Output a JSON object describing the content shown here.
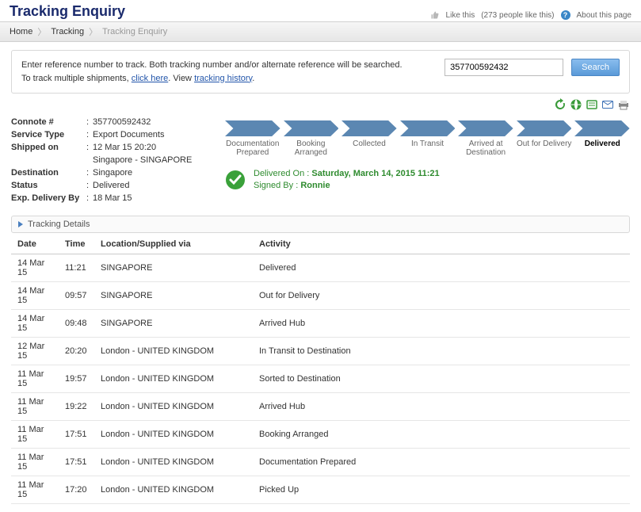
{
  "header": {
    "title": "Tracking Enquiry",
    "like_label": "Like this",
    "like_count": "(273 people like this)",
    "about_label": "About this page"
  },
  "breadcrumb": {
    "home": "Home",
    "tracking": "Tracking",
    "current": "Tracking Enquiry"
  },
  "search": {
    "line1": "Enter reference number to track. Both tracking number and/or alternate reference will be searched.",
    "line2_prefix": "To track multiple shipments, ",
    "click_here": "click here",
    "line2_mid": ". View ",
    "tracking_history": "tracking history",
    "line2_suffix": ".",
    "value": "357700592432",
    "button": "Search"
  },
  "summary": {
    "connote_label": "Connote #",
    "connote_val": "357700592432",
    "service_label": "Service Type",
    "service_val": "Export Documents",
    "shipped_label": "Shipped on",
    "shipped_val1": "12 Mar 15 20:20",
    "shipped_val2": "Singapore - SINGAPORE",
    "dest_label": "Destination",
    "dest_val": "Singapore",
    "status_label": "Status",
    "status_val": "Delivered",
    "expdel_label": "Exp. Delivery By",
    "expdel_val": "18 Mar 15"
  },
  "steps": [
    "Documentation Prepared",
    "Booking Arranged",
    "Collected",
    "In Transit",
    "Arrived at Destination",
    "Out for Delivery",
    "Delivered"
  ],
  "delivered": {
    "on_label": "Delivered On :",
    "on_val": "Saturday, March 14, 2015 11:21",
    "signed_label": "Signed By :",
    "signed_val": "Ronnie"
  },
  "section_title": "Tracking Details",
  "table": {
    "headers": {
      "date": "Date",
      "time": "Time",
      "loc": "Location/Supplied via",
      "act": "Activity"
    },
    "rows": [
      {
        "date": "14 Mar 15",
        "time": "11:21",
        "loc": "SINGAPORE",
        "act": "Delivered"
      },
      {
        "date": "14 Mar 15",
        "time": "09:57",
        "loc": "SINGAPORE",
        "act": "Out for Delivery"
      },
      {
        "date": "14 Mar 15",
        "time": "09:48",
        "loc": "SINGAPORE",
        "act": "Arrived Hub"
      },
      {
        "date": "12 Mar 15",
        "time": "20:20",
        "loc": "London - UNITED KINGDOM",
        "act": "In Transit to Destination"
      },
      {
        "date": "11 Mar 15",
        "time": "19:57",
        "loc": "London - UNITED KINGDOM",
        "act": "Sorted to Destination"
      },
      {
        "date": "11 Mar 15",
        "time": "19:22",
        "loc": "London - UNITED KINGDOM",
        "act": "Arrived Hub"
      },
      {
        "date": "11 Mar 15",
        "time": "17:51",
        "loc": "London - UNITED KINGDOM",
        "act": "Booking Arranged"
      },
      {
        "date": "11 Mar 15",
        "time": "17:51",
        "loc": "London - UNITED KINGDOM",
        "act": "Documentation Prepared"
      },
      {
        "date": "11 Mar 15",
        "time": "17:20",
        "loc": "London - UNITED KINGDOM",
        "act": "Picked Up"
      }
    ]
  }
}
